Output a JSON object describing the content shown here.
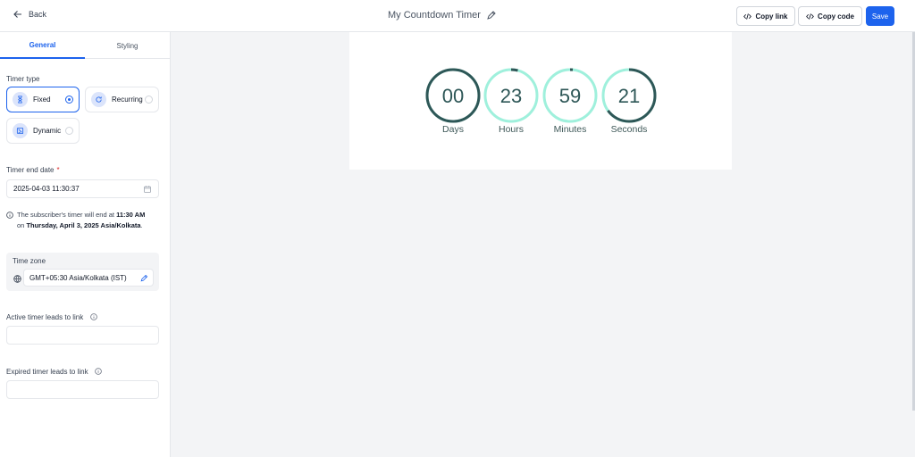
{
  "topbar": {
    "back_label": "Back",
    "title": "My Countdown Timer",
    "copy_link_label": "Copy link",
    "copy_code_label": "Copy code",
    "save_label": "Save"
  },
  "tabs": {
    "general": "General",
    "styling": "Styling"
  },
  "timer_type": {
    "label": "Timer type",
    "options": [
      "Fixed",
      "Recurring",
      "Dynamic"
    ],
    "selected": "Fixed"
  },
  "end_date": {
    "label": "Timer end date",
    "required_mark": "*",
    "value": "2025-04-03 11:30:37"
  },
  "info": {
    "prefix": "The subscriber's timer will end at",
    "time": "11:30 AM",
    "on": "on",
    "date": "Thursday, April 3, 2025 Asia/Kolkata",
    "suffix": "."
  },
  "timezone": {
    "label": "Time zone",
    "value": "GMT+05:30 Asia/Kolkata (IST)"
  },
  "active_link": {
    "label": "Active timer leads to link",
    "value": ""
  },
  "expired_link": {
    "label": "Expired timer leads to link",
    "value": ""
  },
  "countdown": {
    "units": [
      {
        "value": "00",
        "label": "Days"
      },
      {
        "value": "23",
        "label": "Hours"
      },
      {
        "value": "59",
        "label": "Minutes"
      },
      {
        "value": "21",
        "label": "Seconds"
      }
    ],
    "ring_color": "#9ff0dc",
    "progress_color": "#2e5757",
    "text_color": "#2e5757"
  },
  "colors": {
    "accent": "#1d63ed"
  }
}
